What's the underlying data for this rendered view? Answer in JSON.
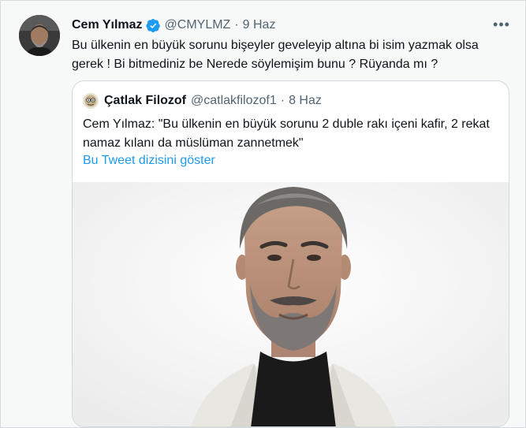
{
  "tweet": {
    "author_name": "Cem Yılmaz",
    "author_handle": "@CMYLMZ",
    "separator": "·",
    "date": "9 Haz",
    "more_label": "•••",
    "text": "Bu ülkenin en büyük sorunu bişeyler geveleyip altına bi isim yazmak olsa gerek ! Bi bitmediniz be Nerede söylemişim bunu ? Rüyanda mı ?"
  },
  "quoted": {
    "author_name": "Çatlak Filozof",
    "author_handle": "@catlakfilozof1",
    "separator": "·",
    "date": "8 Haz",
    "text": "Cem Yılmaz: \"Bu ülkenin en büyük sorunu 2 duble rakı içeni kafir, 2 rekat namaz kılanı da müslüman zannetmek\"",
    "thread_link": "Bu Tweet dizisini göster"
  },
  "colors": {
    "accent": "#1d9bf0",
    "verified": "#1d9bf0",
    "secondary_text": "#536471",
    "primary_text": "#0f1419",
    "border": "#cfd9de"
  },
  "icons": {
    "verified": "verified-badge-icon",
    "more": "more-options-icon"
  }
}
